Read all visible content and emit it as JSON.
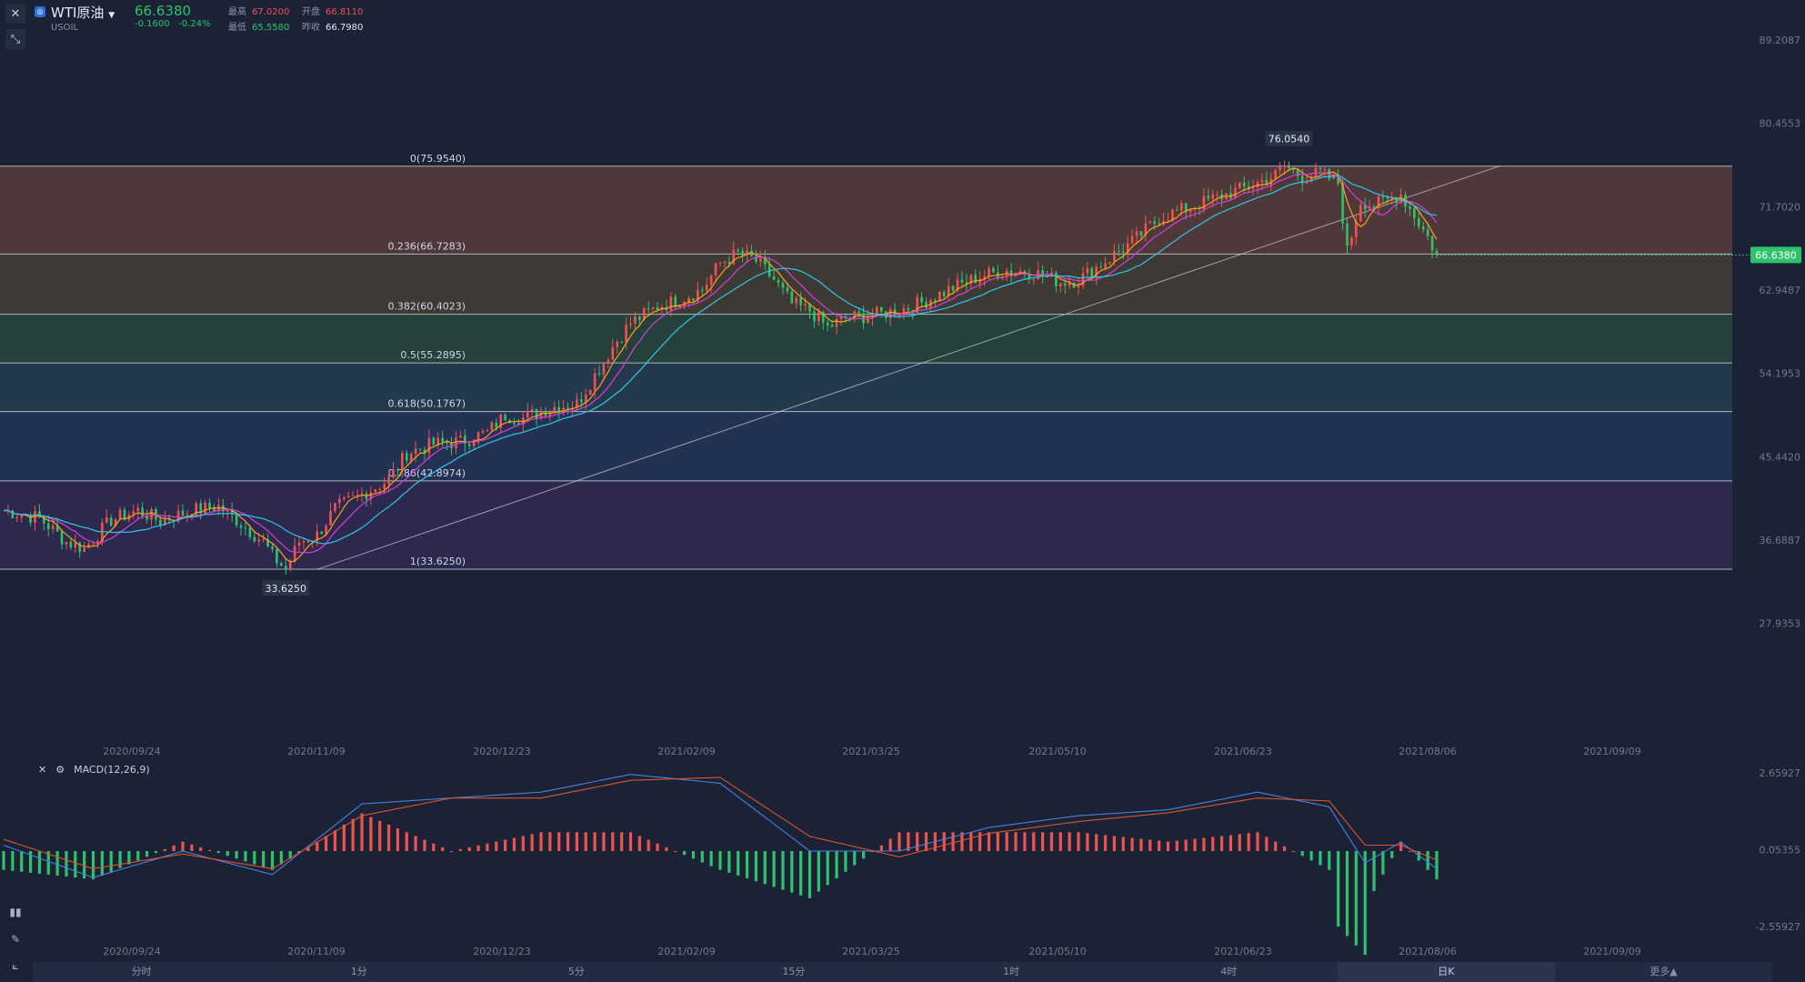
{
  "header": {
    "symbol_name": "WTI原油",
    "symbol_code": "USOIL",
    "last_price": "66.6380",
    "change": "-0.1600",
    "change_pct": "-0.24%",
    "high_label": "最高",
    "high_value": "67.0200",
    "open_label": "开盘",
    "open_value": "66.8110",
    "low_label": "最低",
    "low_value": "65.5580",
    "prev_label": "昨收",
    "prev_value": "66.7980"
  },
  "price_axis": [
    "89.2087",
    "80.4553",
    "71.7020",
    "62.9487",
    "54.1953",
    "45.4420",
    "36.6887",
    "27.9353"
  ],
  "current_price_tag": "66.6380",
  "high_marker": "76.0540",
  "low_marker": "33.6250",
  "fib_levels": [
    {
      "label": "0(75.9540)",
      "value": 75.954,
      "color": "#7a4a3c"
    },
    {
      "label": "0.236(66.7283)",
      "value": 66.7283,
      "color": "#5a4f35"
    },
    {
      "label": "0.382(60.4023)",
      "value": 60.4023,
      "color": "#2f5a3f"
    },
    {
      "label": "0.5(55.2895)",
      "value": 55.2895,
      "color": "#2b4f5e"
    },
    {
      "label": "0.618(50.1767)",
      "value": 50.1767,
      "color": "#29406a"
    },
    {
      "label": "0.786(42.8974)",
      "value": 42.8974,
      "color": "#3a2e63"
    },
    {
      "label": "1(33.6250)",
      "value": 33.625,
      "color": null
    }
  ],
  "date_axis": [
    "2020/09/24",
    "2020/11/09",
    "2020/12/23",
    "2021/02/09",
    "2021/03/25",
    "2021/05/10",
    "2021/06/23",
    "2021/08/06",
    "2021/09/09"
  ],
  "macd": {
    "title": "MACD(12,26,9)",
    "axis": [
      "2.65927",
      "0.05355",
      "-2.55927"
    ],
    "zero_tag": "0.05355"
  },
  "timeframes": [
    "分时",
    "1分",
    "5分",
    "15分",
    "1时",
    "4时",
    "日K",
    "更多▲"
  ],
  "active_timeframe": "日K",
  "colors": {
    "up": "#ef5350",
    "down": "#2fc26b",
    "ma5": "#ff9f1a",
    "ma10": "#d63fd6",
    "ma20": "#2ec7e6",
    "trend": "#cfcfcf"
  },
  "chart_data": {
    "type": "candlestick",
    "description": "Daily candlestick (K-line) chart of WTI crude oil with Fibonacci retracement, trend line, MA lines and MACD subchart",
    "y_range": [
      23.5,
      91.5
    ],
    "close_path": [
      [
        0,
        39.8
      ],
      [
        8,
        39.0
      ],
      [
        14,
        36.5
      ],
      [
        18,
        35.8
      ],
      [
        24,
        38.8
      ],
      [
        30,
        39.8
      ],
      [
        35,
        38.7
      ],
      [
        42,
        39.8
      ],
      [
        48,
        40.2
      ],
      [
        52,
        38.8
      ],
      [
        58,
        36.5
      ],
      [
        60,
        35.0
      ],
      [
        63,
        33.6
      ],
      [
        66,
        36.5
      ],
      [
        70,
        37.2
      ],
      [
        74,
        40.0
      ],
      [
        80,
        41.5
      ],
      [
        86,
        43.0
      ],
      [
        90,
        45.8
      ],
      [
        96,
        46.8
      ],
      [
        102,
        47.0
      ],
      [
        108,
        48.0
      ],
      [
        112,
        49.8
      ],
      [
        116,
        49.5
      ],
      [
        122,
        50.6
      ],
      [
        128,
        51.0
      ],
      [
        132,
        54.0
      ],
      [
        136,
        57.0
      ],
      [
        140,
        59.5
      ],
      [
        146,
        61.2
      ],
      [
        150,
        61.8
      ],
      [
        156,
        63.0
      ],
      [
        160,
        65.8
      ],
      [
        164,
        66.8
      ],
      [
        168,
        66.0
      ],
      [
        172,
        64.0
      ],
      [
        176,
        61.5
      ],
      [
        180,
        60.8
      ],
      [
        184,
        59.0
      ],
      [
        188,
        60.0
      ],
      [
        194,
        60.3
      ],
      [
        200,
        60.8
      ],
      [
        206,
        61.8
      ],
      [
        212,
        63.2
      ],
      [
        218,
        64.4
      ],
      [
        224,
        65.0
      ],
      [
        230,
        64.8
      ],
      [
        236,
        63.8
      ],
      [
        240,
        64.0
      ],
      [
        246,
        66.0
      ],
      [
        252,
        68.0
      ],
      [
        258,
        70.5
      ],
      [
        264,
        71.5
      ],
      [
        270,
        72.5
      ],
      [
        276,
        73.5
      ],
      [
        280,
        74.2
      ],
      [
        284,
        75.0
      ],
      [
        286,
        76.0
      ],
      [
        290,
        74.8
      ],
      [
        294,
        75.2
      ],
      [
        298,
        74.2
      ],
      [
        300,
        67.0
      ],
      [
        303,
        72.3
      ],
      [
        306,
        71.8
      ],
      [
        310,
        72.6
      ],
      [
        312,
        73.0
      ],
      [
        315,
        70.8
      ],
      [
        318,
        68.5
      ],
      [
        320,
        66.6
      ]
    ],
    "macd_dif_path": [
      [
        0,
        0.2
      ],
      [
        20,
        -0.9
      ],
      [
        40,
        0.0
      ],
      [
        60,
        -0.8
      ],
      [
        80,
        1.6
      ],
      [
        100,
        1.8
      ],
      [
        120,
        2.0
      ],
      [
        140,
        2.6
      ],
      [
        160,
        2.3
      ],
      [
        180,
        0.0
      ],
      [
        200,
        0.0
      ],
      [
        220,
        0.8
      ],
      [
        240,
        1.2
      ],
      [
        260,
        1.4
      ],
      [
        280,
        2.0
      ],
      [
        296,
        1.5
      ],
      [
        304,
        -0.4
      ],
      [
        312,
        0.3
      ],
      [
        320,
        -0.6
      ]
    ],
    "macd_dea_path": [
      [
        0,
        0.4
      ],
      [
        20,
        -0.6
      ],
      [
        40,
        -0.1
      ],
      [
        60,
        -0.6
      ],
      [
        80,
        1.2
      ],
      [
        100,
        1.8
      ],
      [
        120,
        1.8
      ],
      [
        140,
        2.4
      ],
      [
        160,
        2.5
      ],
      [
        180,
        0.5
      ],
      [
        200,
        -0.2
      ],
      [
        220,
        0.6
      ],
      [
        240,
        1.0
      ],
      [
        260,
        1.3
      ],
      [
        280,
        1.8
      ],
      [
        296,
        1.7
      ],
      [
        304,
        0.2
      ],
      [
        312,
        0.2
      ],
      [
        320,
        -0.3
      ]
    ]
  }
}
